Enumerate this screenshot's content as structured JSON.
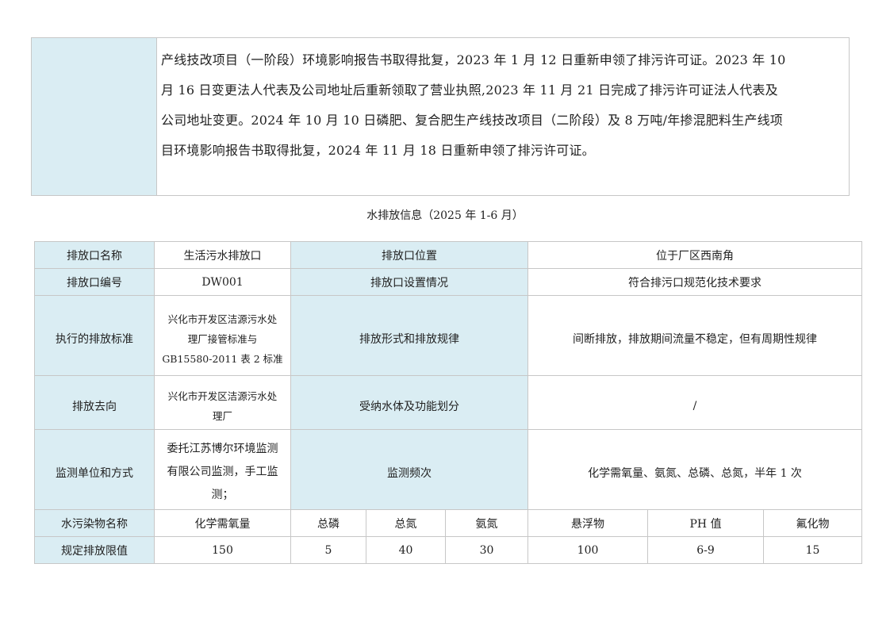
{
  "top_box": {
    "lines": [
      "产线技改项目（一阶段）环境影响报告书取得批复，2023 年 1 月 12 日重新申领了排污许可证。2023 年 10",
      "月  16 日变更法人代表及公司地址后重新领取了营业执照,2023 年  11 月 21 日完成了排污许可证法人代表及",
      "公司地址变更。2024 年 10 月 10 日磷肥、复合肥生产线技改项目（二阶段）及 8 万吨/年掺混肥料生产线项",
      "目环境影响报告书取得批复，2024 年 11 月 18 日重新申领了排污许可证。"
    ]
  },
  "section_title": "水排放信息（2025 年  1-6 月）",
  "table": {
    "row1": {
      "label": "排放口名称",
      "value": "生活污水排放口",
      "label2": "排放口位置",
      "value2": "位于厂区西南角"
    },
    "row2": {
      "label": "排放口编号",
      "value": "DW001",
      "label2": "排放口设置情况",
      "value2": "符合排污口规范化技术要求"
    },
    "row3": {
      "label": "执行的排放标准",
      "value_lines": [
        "兴化市开发区洁源污水处",
        "理厂接管标准与",
        "GB15580-2011 表 2 标准"
      ],
      "label2": "排放形式和排放规律",
      "value2": "间断排放，排放期间流量不稳定，但有周期性规律"
    },
    "row4": {
      "label": "排放去向",
      "value_lines": [
        "兴化市开发区洁源污水处",
        "理厂"
      ],
      "label2": "受纳水体及功能划分",
      "value2": "/"
    },
    "row5": {
      "label": "监测单位和方式",
      "value_lines": [
        "委托江苏博尔环境监测",
        "有限公司监测，手工监",
        "测；"
      ],
      "label2": "监测频次",
      "value2": "化学需氧量、氨氮、总磷、总氮，半年 1 次"
    },
    "pollutant_row": {
      "label": "水污染物名称",
      "items": [
        "化学需氧量",
        "总磷",
        "总氮",
        "氨氮",
        "悬浮物",
        "PH 值",
        "氟化物"
      ]
    },
    "limit_row": {
      "label": "规定排放限值",
      "values": [
        "150",
        "5",
        "40",
        "30",
        "100",
        "6-9",
        "15"
      ]
    }
  }
}
